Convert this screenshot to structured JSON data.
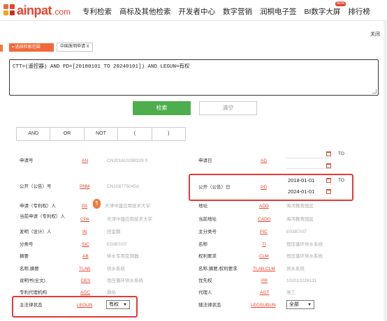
{
  "header": {
    "brand": "ainpat",
    "brand_suffix": ".com",
    "nav": [
      "专利检索",
      "商标及其他检索",
      "开发者中心",
      "数字营销",
      "润桐电子签",
      "BI数字大屏",
      "排行榜"
    ],
    "new_badge": "NEW"
  },
  "panel": {
    "close_label": "关闭",
    "select_scope_label": "▾ 选择检索范围",
    "scope_chip": "中国发明申请 X",
    "query_text": "CTT=(遥控器) AND PD=[20180101 TO 20240101]) AND LEGUN=有权",
    "search_button": "检索",
    "clear_button": "清空",
    "ops": [
      "AND",
      "OR",
      "NOT",
      "(",
      ")"
    ]
  },
  "fields_left": [
    {
      "label": "申请号",
      "code": "AN",
      "value": "CN201810288329.0"
    },
    {
      "label": "公开（公告）号",
      "code": "PNM",
      "value": "CN108775045A"
    },
    {
      "label": "申请（专利权）人",
      "code": "PA",
      "value": "天津中盛应用技术大学"
    },
    {
      "label": "当前申请（专利权）人",
      "code": "CPA",
      "value": "天津中盛应用技术大学"
    },
    {
      "label": "发明（设计）人",
      "code": "IN",
      "value": "田金鹏"
    },
    {
      "label": "分类号",
      "code": "SIC",
      "value": "E03B7/07"
    },
    {
      "label": "摘要",
      "code": "AB",
      "value": "供水专用变频器"
    },
    {
      "label": "名称,摘要",
      "code": "TI,AB",
      "value": "供水系统"
    },
    {
      "label": "说明书(全文)",
      "code": "DES",
      "value": "恒压循环供水系统"
    },
    {
      "label": "专利代理机构",
      "code": "AGC",
      "value": "鼎佑"
    },
    {
      "label": "主法律状态",
      "code": "LEGUN",
      "value": "有权"
    }
  ],
  "fields_right": [
    {
      "label": "申请日",
      "code": "AD",
      "value": ""
    },
    {
      "label": "公开（公告）日",
      "code": "PD",
      "value": ""
    },
    {
      "label": "地址",
      "code": "ADD",
      "value": "海河教育园区"
    },
    {
      "label": "当前地址",
      "code": "CADD",
      "value": "海河教育园区"
    },
    {
      "label": "主分类号",
      "code": "PIC",
      "value": "E03B7/07"
    },
    {
      "label": "名称",
      "code": "TI",
      "value": "恒压循环供水系统"
    },
    {
      "label": "权利要求",
      "code": "CLM",
      "value": "恒压循环供水系统"
    },
    {
      "label": "名称,摘要,权利要求",
      "code": "TI,AB,CLM",
      "value": "供水系统"
    },
    {
      "label": "优先权",
      "code": "PR",
      "value": "102013226131"
    },
    {
      "label": "代理人",
      "code": "AGT",
      "value": "张三"
    },
    {
      "label": "辅法律状态",
      "code": "LEGSUBUN",
      "value": "全部"
    }
  ],
  "dates": {
    "to_label": "TO",
    "pd_from": "2018-01-01",
    "pd_to": "2024-01-01"
  },
  "colors": {
    "brand": "#e8442e",
    "accent": "#f2683a",
    "search_green": "#4cae4c",
    "highlight": "#e53935"
  }
}
